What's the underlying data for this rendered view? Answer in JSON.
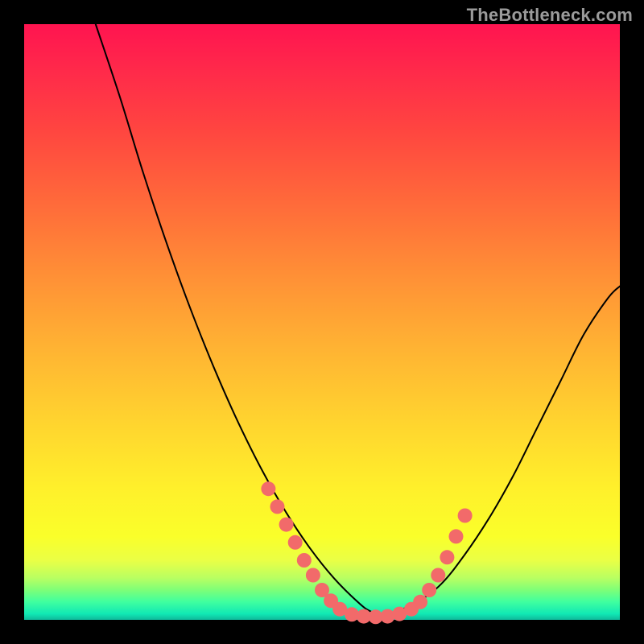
{
  "watermark": "TheBottleneck.com",
  "colors": {
    "curve_stroke": "#000000",
    "marker_fill": "#f26a6a",
    "marker_stroke": "#f26a6a"
  },
  "chart_data": {
    "type": "line",
    "title": "",
    "xlabel": "",
    "ylabel": "",
    "xlim": [
      0,
      100
    ],
    "ylim": [
      0,
      100
    ],
    "grid": false,
    "legend": false,
    "series": [
      {
        "name": "bottleneck-curve",
        "x": [
          12,
          16,
          20,
          24,
          28,
          32,
          36,
          40,
          44,
          48,
          52,
          56,
          58,
          60,
          62,
          66,
          70,
          74,
          78,
          82,
          86,
          90,
          94,
          98,
          100
        ],
        "y": [
          100,
          88,
          75,
          63,
          52,
          42,
          33,
          25,
          18,
          12,
          7,
          3,
          1.5,
          0.8,
          1.2,
          3,
          6,
          11,
          17,
          24,
          32,
          40,
          48,
          54,
          56
        ]
      }
    ],
    "markers": [
      {
        "x": 41,
        "y": 22
      },
      {
        "x": 42.5,
        "y": 19
      },
      {
        "x": 44,
        "y": 16
      },
      {
        "x": 45.5,
        "y": 13
      },
      {
        "x": 47,
        "y": 10
      },
      {
        "x": 48.5,
        "y": 7.5
      },
      {
        "x": 50,
        "y": 5
      },
      {
        "x": 51.5,
        "y": 3.2
      },
      {
        "x": 53,
        "y": 1.8
      },
      {
        "x": 55,
        "y": 0.9
      },
      {
        "x": 57,
        "y": 0.6
      },
      {
        "x": 59,
        "y": 0.5
      },
      {
        "x": 61,
        "y": 0.6
      },
      {
        "x": 63,
        "y": 1.0
      },
      {
        "x": 65,
        "y": 1.8
      },
      {
        "x": 66.5,
        "y": 3.0
      },
      {
        "x": 68,
        "y": 5.0
      },
      {
        "x": 69.5,
        "y": 7.5
      },
      {
        "x": 71,
        "y": 10.5
      },
      {
        "x": 72.5,
        "y": 14
      },
      {
        "x": 74,
        "y": 17.5
      }
    ]
  }
}
